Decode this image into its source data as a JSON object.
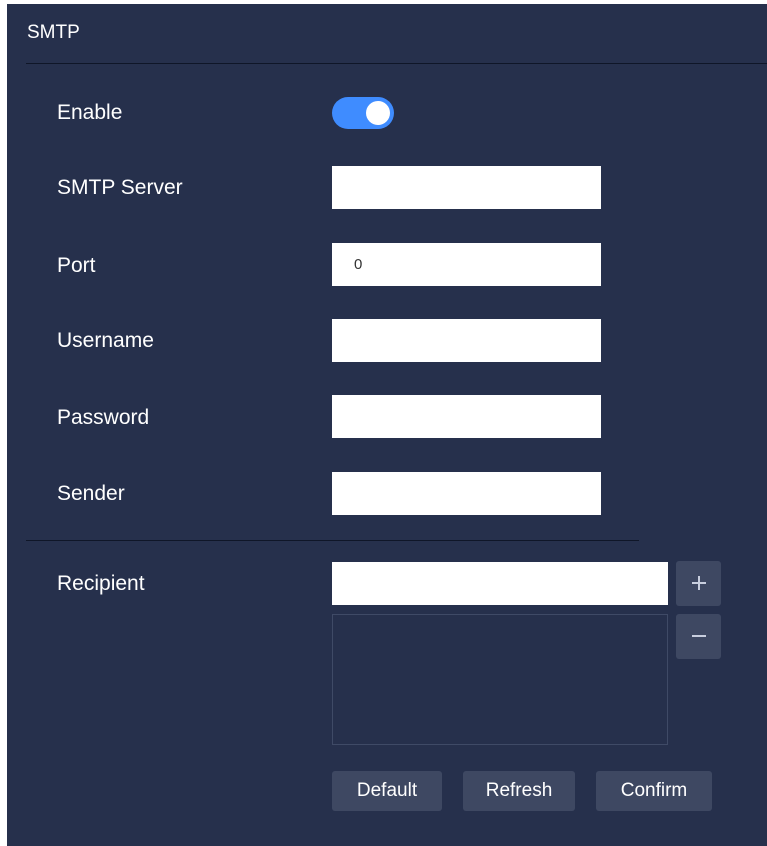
{
  "panel": {
    "title": "SMTP"
  },
  "form": {
    "enable": {
      "label": "Enable",
      "enabled": true,
      "accent_color": "#3f8cff"
    },
    "smtp_server": {
      "label": "SMTP Server",
      "value": ""
    },
    "port": {
      "label": "Port",
      "value": "0"
    },
    "username": {
      "label": "Username",
      "value": ""
    },
    "password": {
      "label": "Password",
      "value": ""
    },
    "sender": {
      "label": "Sender",
      "value": ""
    }
  },
  "recipient": {
    "label": "Recipient",
    "value": "",
    "list": [],
    "add_icon": "plus-icon",
    "remove_icon": "minus-icon"
  },
  "actions": {
    "default_label": "Default",
    "refresh_label": "Refresh",
    "confirm_label": "Confirm"
  },
  "colors": {
    "background": "#26304c",
    "button": "#3e4862",
    "accent": "#3f8cff"
  }
}
